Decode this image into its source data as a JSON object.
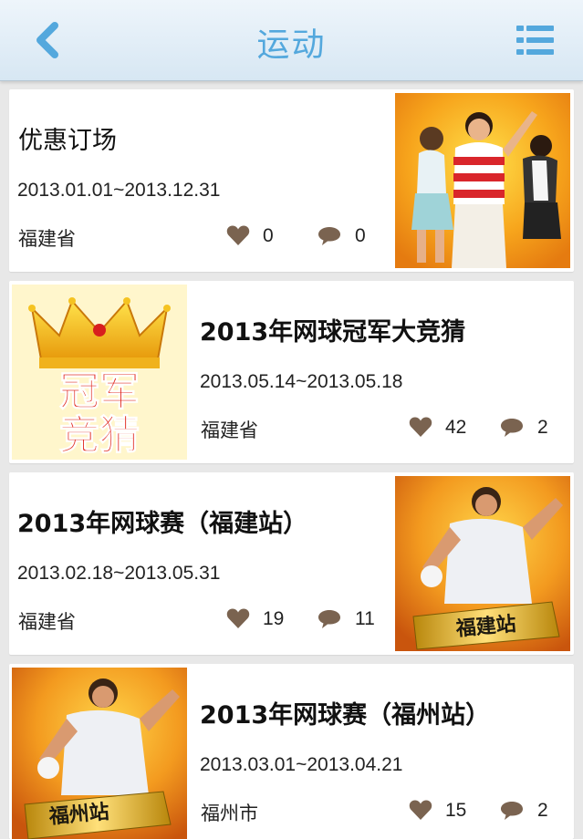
{
  "header": {
    "title": "运动",
    "back_icon": "chevron-left-icon",
    "menu_icon": "list-icon",
    "accent": "#54a8dd"
  },
  "events": [
    {
      "title": "优惠订场",
      "date": "2013.01.01~2013.12.31",
      "region": "福建省",
      "likes": "0",
      "comments": "0"
    },
    {
      "title": "2013年网球冠军大竞猜",
      "date": "2013.05.14~2013.05.18",
      "region": "福建省",
      "likes": "42",
      "comments": "2",
      "image_text": [
        "冠军",
        "竞猜"
      ]
    },
    {
      "title": "2013年网球赛（福建站）",
      "date": "2013.02.18~2013.05.31",
      "region": "福建省",
      "likes": "19",
      "comments": "11",
      "image_text": "福建站"
    },
    {
      "title": "2013年网球赛（福州站）",
      "date": "2013.03.01~2013.04.21",
      "region": "福州市",
      "likes": "15",
      "comments": "2",
      "image_text": "福州站"
    }
  ],
  "icons": {
    "like": "heart-icon",
    "comment": "comment-bubble-icon"
  },
  "colors": {
    "icon": "#7a6350",
    "background": "#e8e8e8"
  }
}
